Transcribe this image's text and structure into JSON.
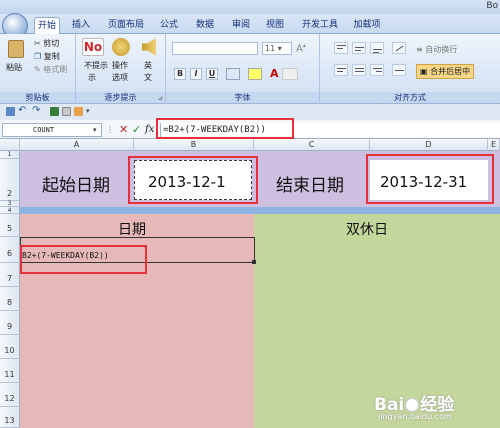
{
  "window": {
    "title": "Bo"
  },
  "tabs": [
    "开始",
    "插入",
    "页面布局",
    "公式",
    "数据",
    "审阅",
    "视图",
    "开发工具",
    "加载项"
  ],
  "ribbon": {
    "clipboard": {
      "paste": "粘贴",
      "cut": "剪切",
      "copy": "复制",
      "format_painter": "格式刷",
      "label": "剪贴板"
    },
    "step_prompt": {
      "no_prompt": "不提示",
      "no_prompt_2": "示",
      "ops": "操作",
      "ops_2": "选项",
      "english": "英",
      "english_2": "文",
      "label": "逐步提示"
    },
    "font": {
      "font_size": "11",
      "label": "字体"
    },
    "alignment": {
      "wrap": "自动换行",
      "merge": "合并后居中",
      "label": "对齐方式"
    }
  },
  "formula_bar": {
    "name_box": "COUNT",
    "formula": "=B2+(7-WEEKDAY(B2))"
  },
  "columns": [
    "A",
    "B",
    "C",
    "D",
    "E"
  ],
  "rows": [
    "1",
    "2",
    "3",
    "4",
    "5",
    "6",
    "7",
    "8",
    "9",
    "10",
    "11",
    "12",
    "13"
  ],
  "sheet": {
    "start_label": "起始日期",
    "start_value": "2013-12-1",
    "end_label": "结束日期",
    "end_value": "2013-12-31",
    "col_date": "日期",
    "col_weekend": "双休日",
    "editing_cell": "B2+(7-WEEKDAY(B2))"
  },
  "watermark": {
    "brand": "Bai",
    "brand2": "经验",
    "url": "jingyan.baidu.com"
  },
  "colors": {
    "pink": "#e6b8b8",
    "green": "#c3d69b",
    "lavender": "#cdbfdf",
    "blue_band": "#8db3e2",
    "red": "#e8303a"
  }
}
